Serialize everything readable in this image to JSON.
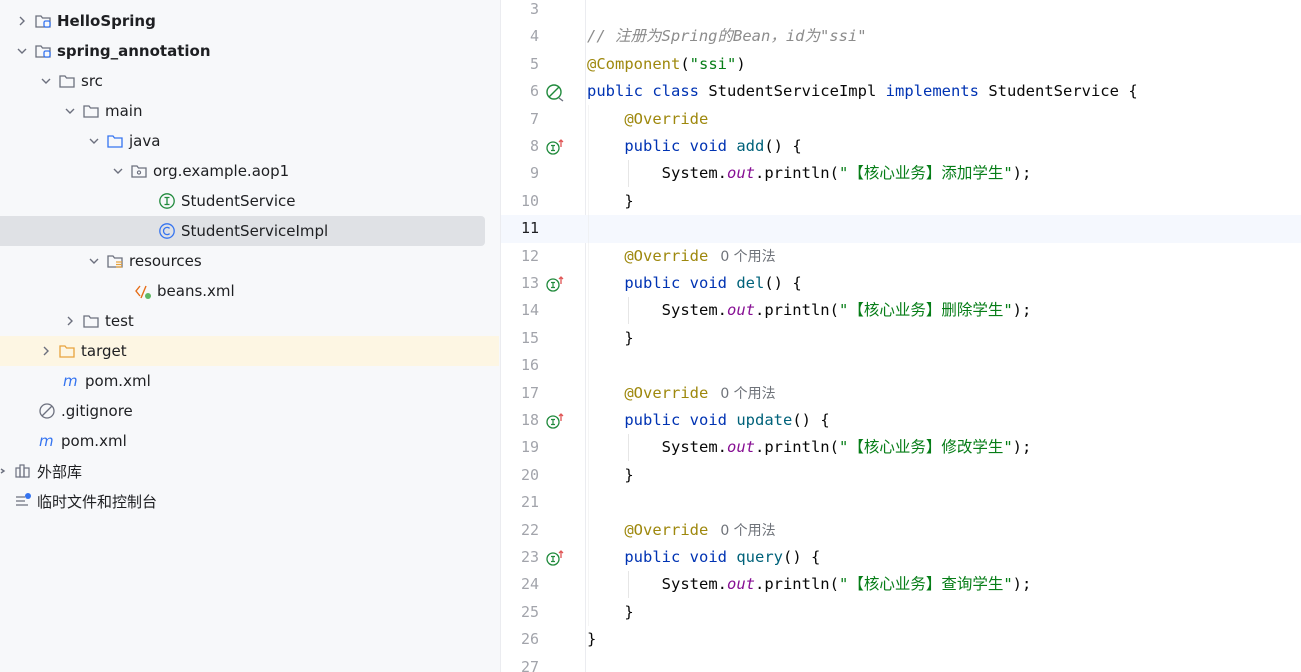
{
  "project_tree": {
    "nodes": [
      {
        "label": "HelloSpring",
        "icon": "module-icon",
        "bold": true
      },
      {
        "label": "spring_annotation",
        "icon": "module-icon",
        "bold": true
      },
      {
        "label": "src",
        "icon": "folder-icon"
      },
      {
        "label": "main",
        "icon": "folder-icon"
      },
      {
        "label": "java",
        "icon": "source-folder-icon"
      },
      {
        "label": "org.example.aop1",
        "icon": "package-icon"
      },
      {
        "label": "StudentService",
        "icon": "interface-icon"
      },
      {
        "label": "StudentServiceImpl",
        "icon": "class-icon"
      },
      {
        "label": "resources",
        "icon": "resources-folder-icon"
      },
      {
        "label": "beans.xml",
        "icon": "xml-icon"
      },
      {
        "label": "test",
        "icon": "folder-icon"
      },
      {
        "label": "target",
        "icon": "excluded-folder-icon"
      },
      {
        "label": "pom.xml",
        "icon": "maven-icon"
      },
      {
        "label": ".gitignore",
        "icon": "ignored-file-icon"
      },
      {
        "label": "pom.xml",
        "icon": "maven-icon"
      },
      {
        "label": "外部库",
        "icon": "libraries-icon"
      },
      {
        "label": "临时文件和控制台",
        "icon": "scratches-icon"
      }
    ]
  },
  "editor": {
    "current_line": 11,
    "line_numbers": [
      "3",
      "4",
      "5",
      "6",
      "7",
      "8",
      "9",
      "10",
      "11",
      "12",
      "13",
      "14",
      "15",
      "16",
      "17",
      "18",
      "19",
      "20",
      "21",
      "22",
      "23",
      "24",
      "25",
      "26",
      "27"
    ],
    "comment": "// 注册为Spring的Bean，id为\"ssi\"",
    "component_annotation": "@Component",
    "component_arg": "\"ssi\"",
    "class_kw": "public class",
    "class_name": "StudentServiceImpl",
    "implements_kw": "implements",
    "interface_name": "StudentService",
    "override": "@Override",
    "method_kw": "public void",
    "usage_hint": "0 个用法",
    "system": "System.",
    "out": "out",
    "println": ".println(",
    "close_call": ");",
    "methods": [
      {
        "name": "add",
        "message": "\"【核心业务】添加学生\""
      },
      {
        "name": "del",
        "message": "\"【核心业务】删除学生\""
      },
      {
        "name": "update",
        "message": "\"【核心业务】修改学生\""
      },
      {
        "name": "query",
        "message": "\"【核心业务】查询学生\""
      }
    ],
    "colors": {
      "keyword": "#0033b3",
      "annotation": "#9e880d",
      "string": "#067d17",
      "comment": "#8c8c8c",
      "method": "#00627a",
      "static_field": "#871094"
    }
  }
}
